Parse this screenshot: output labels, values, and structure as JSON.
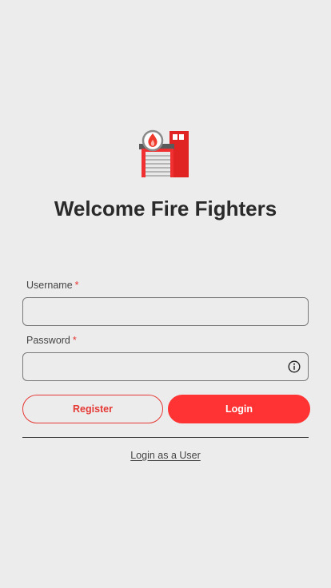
{
  "header": {
    "title": "Welcome Fire Fighters",
    "logo_icon": "fire-station-icon"
  },
  "form": {
    "username": {
      "label": "Username",
      "required_mark": "*",
      "value": ""
    },
    "password": {
      "label": "Password",
      "required_mark": "*",
      "value": "",
      "info_icon": "info-icon"
    }
  },
  "actions": {
    "register_label": "Register",
    "login_label": "Login",
    "user_login_label": "Login as a User"
  },
  "colors": {
    "background": "#ececec",
    "accent": "#ff3333",
    "required": "#e53935",
    "text": "#2a2a2a"
  }
}
